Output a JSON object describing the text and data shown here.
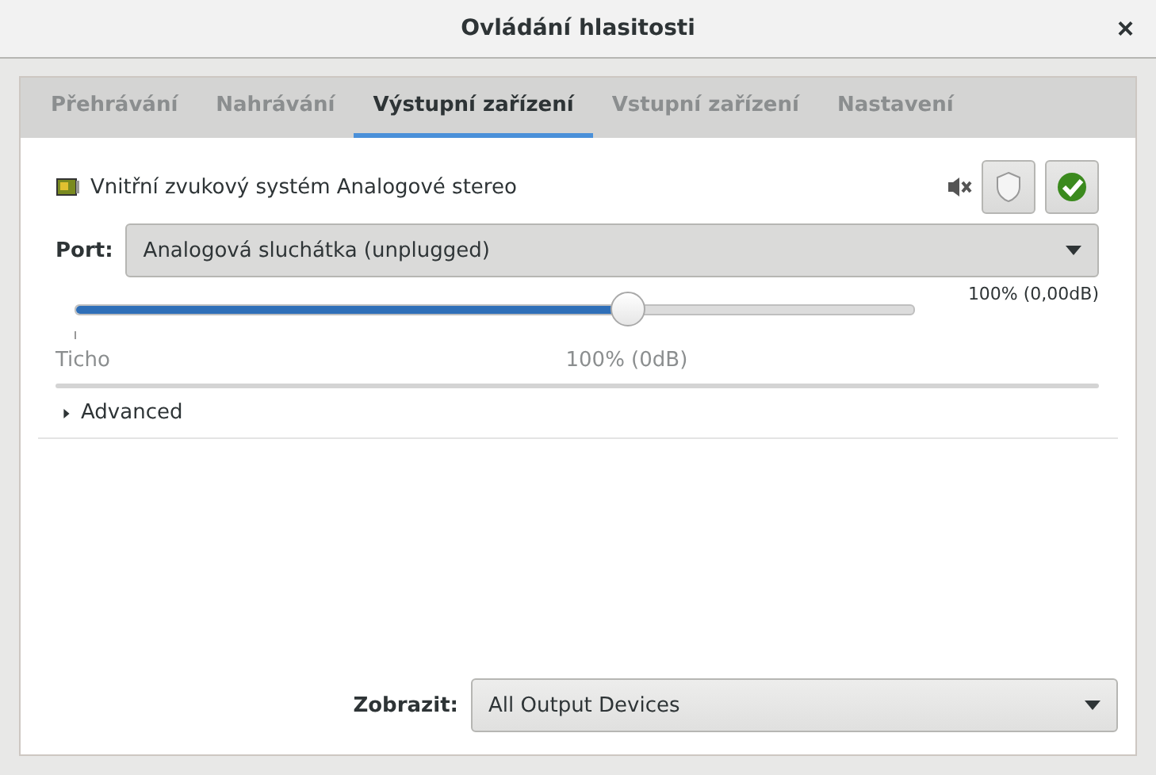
{
  "window": {
    "title": "Ovládání hlasitosti",
    "close": "×"
  },
  "tabs": [
    {
      "label": "Přehrávání",
      "selected": false
    },
    {
      "label": "Nahrávání",
      "selected": false
    },
    {
      "label": "Výstupní zařízení",
      "selected": true
    },
    {
      "label": "Vstupní zařízení",
      "selected": false
    },
    {
      "label": "Nastavení",
      "selected": false
    }
  ],
  "device": {
    "name": "Vnitřní zvukový systém Analogové stereo",
    "port_label": "Port:",
    "port": "Analogová sluchátka (unplugged)",
    "level": 0.657,
    "reading": "100% (0,00dB)",
    "min_label": "Ticho",
    "mark_label": "100% (0dB)",
    "advanced": {
      "label": "Advanced",
      "expanded": false
    }
  },
  "footer": {
    "label": "Zobrazit:",
    "value": "All Output Devices"
  }
}
